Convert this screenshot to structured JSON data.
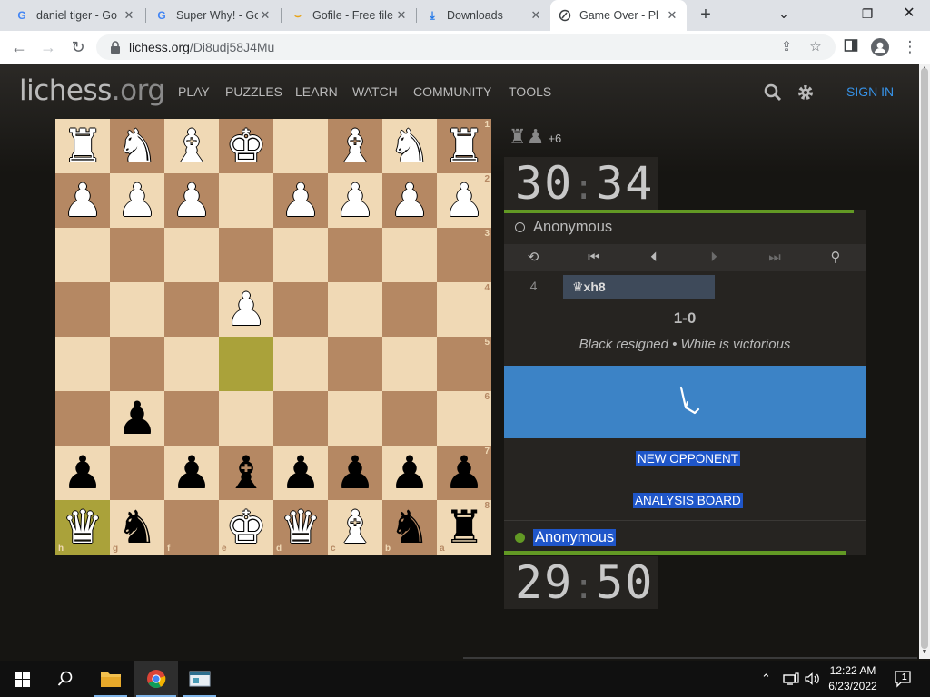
{
  "browser": {
    "tabs": [
      {
        "title": "daniel tiger - Go",
        "favicon": "google-icon",
        "active": false
      },
      {
        "title": "Super Why! - Go",
        "favicon": "google-icon",
        "active": false
      },
      {
        "title": "Gofile - Free file",
        "favicon": "gofile-icon",
        "active": false
      },
      {
        "title": "Downloads",
        "favicon": "download-icon",
        "active": false
      },
      {
        "title": "Game Over - Pl",
        "favicon": "lichess-icon",
        "active": true
      }
    ],
    "url_host": "lichess.org",
    "url_path": "/Di8udj58J4Mu"
  },
  "site": {
    "logo_main": "lichess",
    "logo_tld": ".org",
    "nav": [
      "PLAY",
      "PUZZLES",
      "LEARN",
      "WATCH",
      "COMMUNITY",
      "TOOLS"
    ],
    "signin": "SIGN IN"
  },
  "board": {
    "rank_labels": [
      "1",
      "2",
      "3",
      "4",
      "5",
      "6",
      "7",
      "8"
    ],
    "file_labels": [
      "h",
      "g",
      "f",
      "e",
      "d",
      "c",
      "b",
      "a"
    ],
    "highlight": [
      {
        "row": 4,
        "col": 3
      },
      {
        "row": 7,
        "col": 0
      }
    ],
    "pieces": [
      {
        "row": 0,
        "col": 0,
        "glyph": "♜",
        "color": "w",
        "name": "white-rook"
      },
      {
        "row": 0,
        "col": 1,
        "glyph": "♞",
        "color": "w",
        "name": "white-knight"
      },
      {
        "row": 0,
        "col": 2,
        "glyph": "♝",
        "color": "w",
        "name": "white-bishop"
      },
      {
        "row": 0,
        "col": 3,
        "glyph": "♚",
        "color": "w",
        "name": "white-king"
      },
      {
        "row": 0,
        "col": 5,
        "glyph": "♝",
        "color": "w",
        "name": "white-bishop"
      },
      {
        "row": 0,
        "col": 6,
        "glyph": "♞",
        "color": "w",
        "name": "white-knight"
      },
      {
        "row": 0,
        "col": 7,
        "glyph": "♜",
        "color": "w",
        "name": "white-rook"
      },
      {
        "row": 1,
        "col": 0,
        "glyph": "♟",
        "color": "w",
        "name": "white-pawn"
      },
      {
        "row": 1,
        "col": 1,
        "glyph": "♟",
        "color": "w",
        "name": "white-pawn"
      },
      {
        "row": 1,
        "col": 2,
        "glyph": "♟",
        "color": "w",
        "name": "white-pawn"
      },
      {
        "row": 1,
        "col": 4,
        "glyph": "♟",
        "color": "w",
        "name": "white-pawn"
      },
      {
        "row": 1,
        "col": 5,
        "glyph": "♟",
        "color": "w",
        "name": "white-pawn"
      },
      {
        "row": 1,
        "col": 6,
        "glyph": "♟",
        "color": "w",
        "name": "white-pawn"
      },
      {
        "row": 1,
        "col": 7,
        "glyph": "♟",
        "color": "w",
        "name": "white-pawn"
      },
      {
        "row": 3,
        "col": 3,
        "glyph": "♟",
        "color": "w",
        "name": "white-pawn"
      },
      {
        "row": 5,
        "col": 1,
        "glyph": "♟",
        "color": "b",
        "name": "black-pawn"
      },
      {
        "row": 6,
        "col": 0,
        "glyph": "♟",
        "color": "b",
        "name": "black-pawn"
      },
      {
        "row": 6,
        "col": 2,
        "glyph": "♟",
        "color": "b",
        "name": "black-pawn"
      },
      {
        "row": 6,
        "col": 3,
        "glyph": "♝",
        "color": "b",
        "name": "black-bishop"
      },
      {
        "row": 6,
        "col": 4,
        "glyph": "♟",
        "color": "b",
        "name": "black-pawn"
      },
      {
        "row": 6,
        "col": 5,
        "glyph": "♟",
        "color": "b",
        "name": "black-pawn"
      },
      {
        "row": 6,
        "col": 6,
        "glyph": "♟",
        "color": "b",
        "name": "black-pawn"
      },
      {
        "row": 6,
        "col": 7,
        "glyph": "♟",
        "color": "b",
        "name": "black-pawn"
      },
      {
        "row": 7,
        "col": 0,
        "glyph": "♛",
        "color": "w",
        "name": "white-queen"
      },
      {
        "row": 7,
        "col": 1,
        "glyph": "♞",
        "color": "b",
        "name": "black-knight"
      },
      {
        "row": 7,
        "col": 3,
        "glyph": "♚",
        "color": "w",
        "name": "white-king"
      },
      {
        "row": 7,
        "col": 4,
        "glyph": "♛",
        "color": "w",
        "name": "white-queen"
      },
      {
        "row": 7,
        "col": 5,
        "glyph": "♝",
        "color": "w",
        "name": "white-bishop"
      },
      {
        "row": 7,
        "col": 6,
        "glyph": "♞",
        "color": "b",
        "name": "black-knight"
      },
      {
        "row": 7,
        "col": 7,
        "glyph": "♜",
        "color": "b",
        "name": "black-rook"
      }
    ]
  },
  "game": {
    "captured_glyphs": "♜♟",
    "material_diff": "+6",
    "top_clock": {
      "min": "30",
      "sec": "34"
    },
    "top_player": "Anonymous",
    "move_number": "4",
    "move_san": "♛xh8",
    "result": "1-0",
    "status": "Black resigned • White is victorious",
    "new_opponent": "NEW OPPONENT",
    "analysis_board": "ANALYSIS BOARD",
    "bottom_player": "Anonymous",
    "bottom_clock": {
      "min": "29",
      "sec": "50"
    }
  },
  "taskbar": {
    "time": "12:22 AM",
    "date": "6/23/2022",
    "notification_count": "1"
  },
  "colors": {
    "light_square": "#f0d9b5",
    "dark_square": "#b58863",
    "highlight_square": "#aaa23a",
    "accent_blue": "#3692e7",
    "online_green": "#629924"
  }
}
